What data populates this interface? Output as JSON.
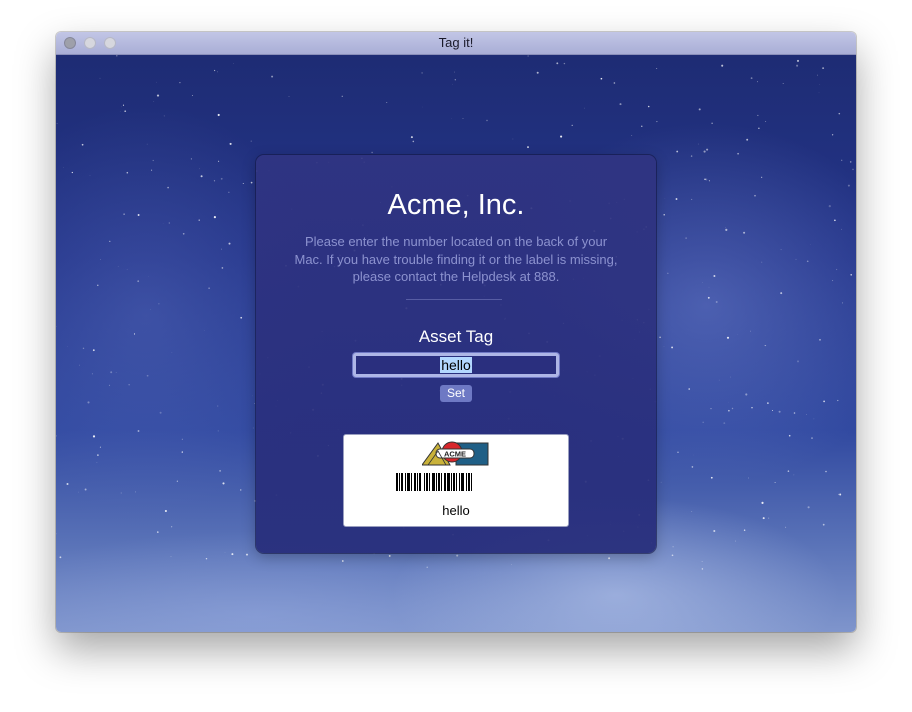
{
  "window": {
    "title": "Tag it!"
  },
  "card": {
    "company_name": "Acme, Inc.",
    "instructions": "Please enter the number located on the back of your Mac. If you have trouble finding it or the label is missing, please contact the Helpdesk at 888.",
    "field_label": "Asset Tag",
    "asset_tag_value": "hello",
    "set_label": "Set"
  },
  "preview": {
    "logo_text": "ACME",
    "tag_text": "hello"
  },
  "colors": {
    "card_bg": "#2e3384",
    "instructions_text": "#8c92cf",
    "button_bg": "#6e79c4",
    "selection": "#b3d7ff"
  },
  "icons": {
    "close": "close-button-icon",
    "minimize": "minimize-button-icon",
    "zoom": "zoom-button-icon",
    "logo": "acme-logo-icon",
    "barcode": "barcode-icon"
  }
}
